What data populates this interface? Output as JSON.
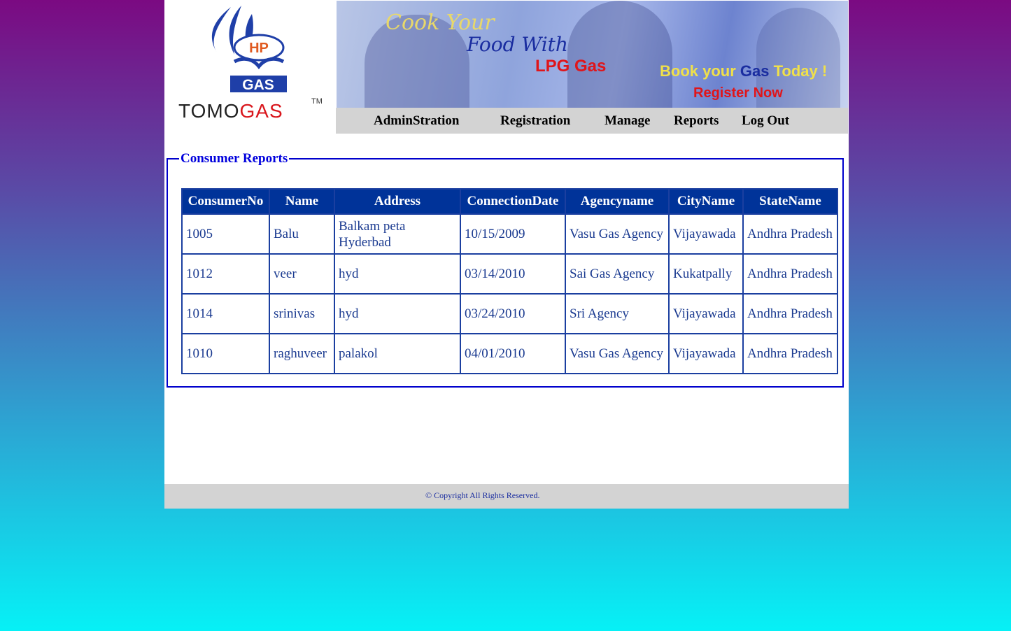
{
  "logo": {
    "hp": "HP",
    "gas": "GAS",
    "brand_part1": "TOMO",
    "brand_part2": "GAS",
    "tm": "TM"
  },
  "banner": {
    "line1": "Cook Your",
    "line2": "Food With",
    "line3": "LPG Gas",
    "line4_a": "Book your ",
    "line4_b": "Gas",
    "line4_c": " Today !",
    "line5": "Register Now"
  },
  "nav": [
    "AdminStration",
    "Registration",
    "Manage",
    "Reports",
    "Log Out"
  ],
  "report": {
    "legend": "Consumer Reports",
    "columns": [
      "ConsumerNo",
      "Name",
      "Address",
      "ConnectionDate",
      "Agencyname",
      "CityName",
      "StateName"
    ],
    "rows": [
      [
        "1005",
        "Balu",
        "Balkam peta Hyderbad",
        "10/15/2009",
        "Vasu Gas Agency",
        "Vijayawada",
        "Andhra Pradesh"
      ],
      [
        "1012",
        "veer",
        "hyd",
        "03/14/2010",
        "Sai Gas Agency",
        "Kukatpally",
        "Andhra Pradesh"
      ],
      [
        "1014",
        "srinivas",
        "hyd",
        "03/24/2010",
        "Sri Agency",
        "Vijayawada",
        "Andhra Pradesh"
      ],
      [
        "1010",
        "raghuveer",
        "palakol",
        "04/01/2010",
        "Vasu Gas Agency",
        "Vijayawada",
        "Andhra Pradesh"
      ]
    ]
  },
  "footer": {
    "copyright": "© Copyright All Rights Reserved."
  },
  "colors": {
    "header_bg": "#003399",
    "legend": "#0000dd",
    "nav_bg": "#d3d3d3"
  }
}
